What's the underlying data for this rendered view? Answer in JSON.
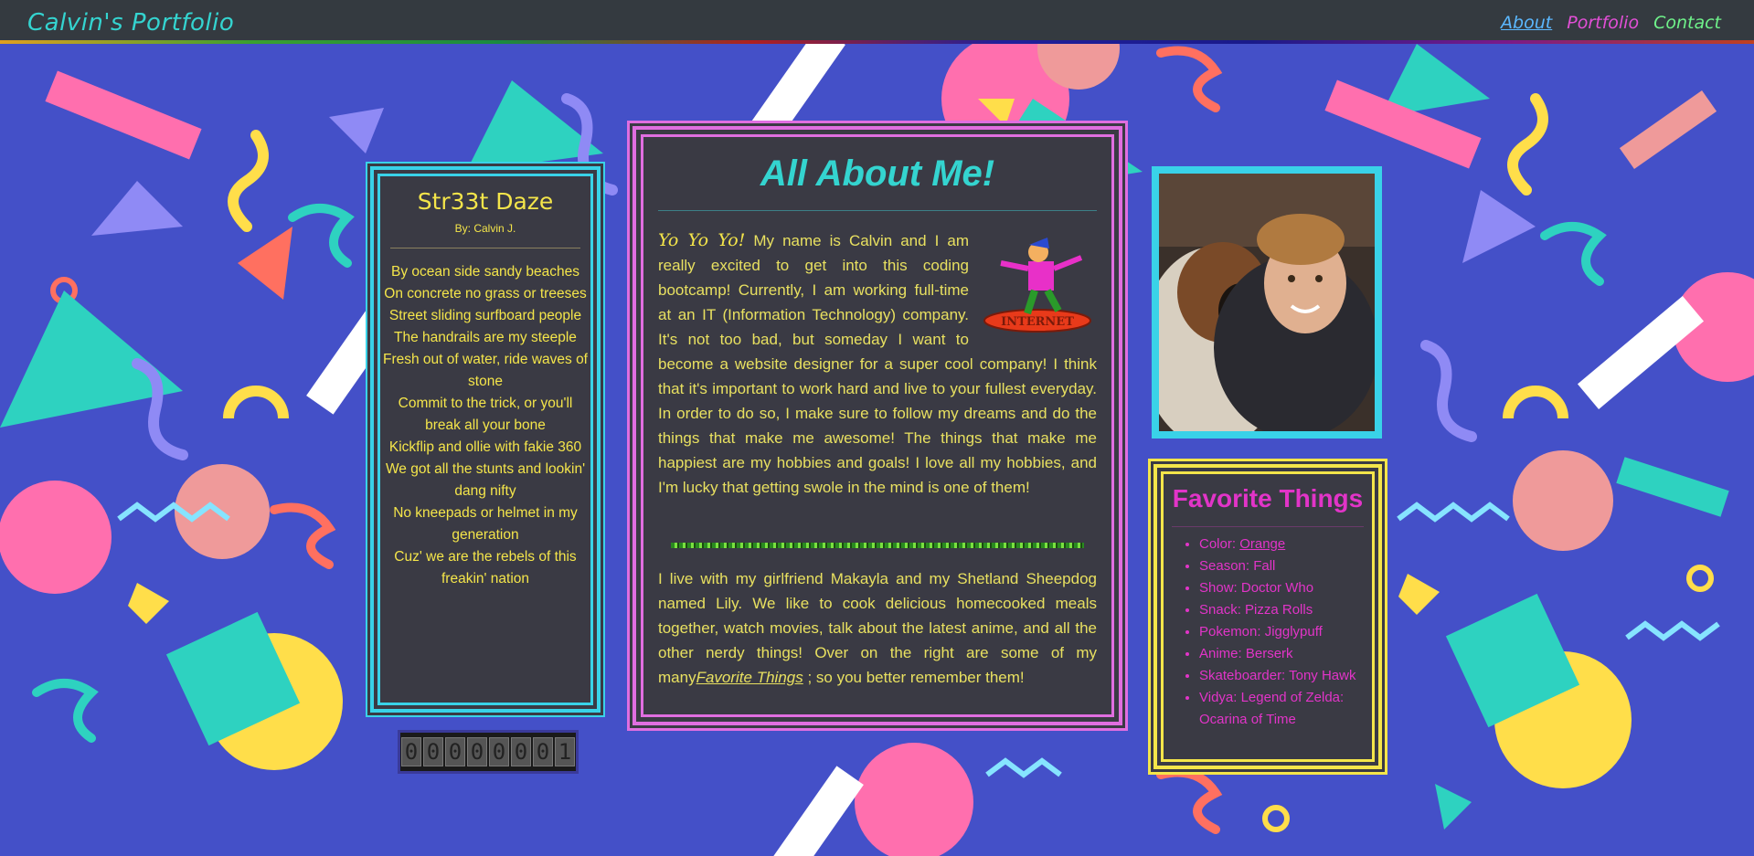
{
  "navbar": {
    "brand": "Calvin's Portfolio",
    "links": [
      "About",
      "Portfolio",
      "Contact"
    ]
  },
  "poem": {
    "title": "Str33t Daze",
    "author": "By: Calvin J.",
    "lines": [
      "By ocean side sandy beaches",
      "On concrete no grass or treeses",
      "Street sliding surfboard people",
      "The handrails are my steeple",
      "Fresh out of water, ride waves of stone",
      "Commit to the trick, or you'll break all your bone",
      "Kickflip and ollie with fakie 360",
      "We got all the stunts and lookin' dang nifty",
      "No kneepads or helmet in my generation",
      "Cuz' we are the rebels of this freakin' nation"
    ]
  },
  "counter": {
    "digits": "00000001"
  },
  "about": {
    "title": "All About Me!",
    "greeting": "Yo Yo Yo!",
    "paragraph1": " My name is Calvin and I am really excited to get into this coding bootcamp! Currently, I am working full-time at an IT (Information Technology) company. It's not too bad, but someday I want to become a website designer for a super cool company! I think that it's important to work hard and live to your fullest everyday. In order to do so, I make sure to follow my dreams and do the things that make me awesome! The things that make me happiest are my hobbies and goals! I love all my hobbies, and I'm lucky that getting swole in the mind is one of them!",
    "surfer_label": "INTERNET",
    "paragraph2_start": "I live with my girlfriend Makayla and my Shetland Sheepdog named Lily. We like to cook delicious homecooked meals together, watch movies, talk about the latest anime, and all the other nerdy things! Over on the right are some of my many",
    "paragraph2_link": "Favorite Things",
    "paragraph2_end": " ; so you better remember them!"
  },
  "favorites": {
    "title": "Favorite Things",
    "items": [
      {
        "label": "Color: ",
        "value": "Orange"
      },
      {
        "label": "Season: Fall",
        "value": ""
      },
      {
        "label": "Show: Doctor Who",
        "value": ""
      },
      {
        "label": "Snack: Pizza Rolls",
        "value": ""
      },
      {
        "label": "Pokemon: Jigglypuff",
        "value": ""
      },
      {
        "label": "Anime: Berserk",
        "value": ""
      },
      {
        "label": "Skateboarder: Tony Hawk",
        "value": ""
      },
      {
        "label": "Vidya: Legend of Zelda: Ocarina of Time",
        "value": ""
      }
    ]
  },
  "colors": {
    "background": "#4450c8",
    "navbar": "#343a40",
    "panel": "#3a3a44",
    "cyan": "#34d4d0",
    "yellow": "#f4e54a",
    "magenta": "#e234c8",
    "pink_border": "#e06ee0"
  }
}
